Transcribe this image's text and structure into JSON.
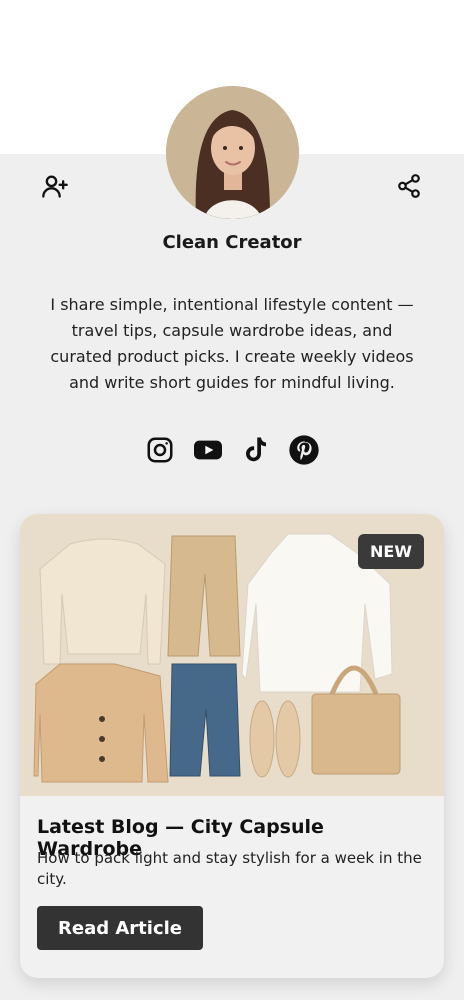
{
  "profile": {
    "name": "Clean Creator",
    "bio": "I share simple, intentional lifestyle content — travel tips, capsule wardrobe ideas, and curated product picks. I create weekly videos and write short guides for mindful living."
  },
  "header": {
    "left_icon": "add-user-icon",
    "right_icon": "share-icon"
  },
  "socials": [
    {
      "icon": "instagram-icon"
    },
    {
      "icon": "youtube-icon"
    },
    {
      "icon": "tiktok-icon"
    },
    {
      "icon": "pinterest-icon"
    }
  ],
  "blog": {
    "badge": "NEW",
    "title": "Latest Blog — City Capsule Wardrobe",
    "description": "How to pack light and stay stylish for a week in the city.",
    "cta_label": "Read Article"
  },
  "colors": {
    "panel_bg": "#efefef",
    "button_bg": "#333333",
    "badge_bg": "#3a3a3a"
  }
}
